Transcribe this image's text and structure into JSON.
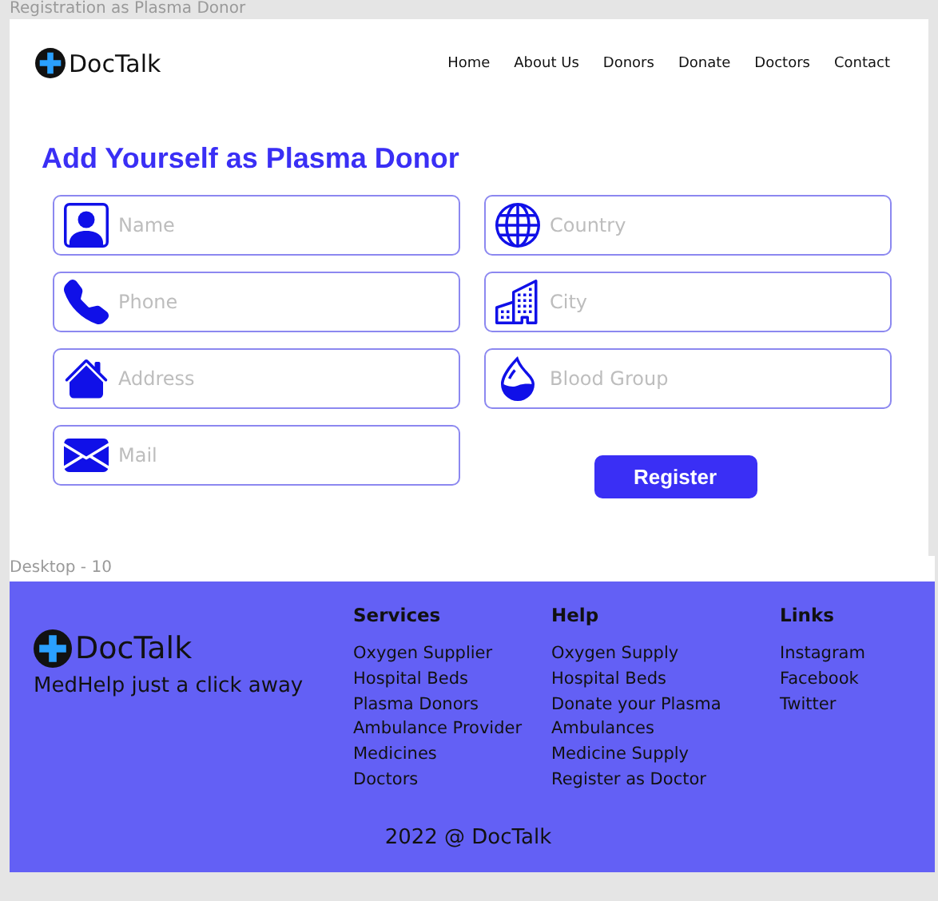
{
  "canvas_frames": [
    {
      "label": "Registration as Plasma Donor"
    },
    {
      "label": "Desktop - 10"
    }
  ],
  "header": {
    "brand": "DocTalk",
    "nav": [
      {
        "label": "Home"
      },
      {
        "label": "About Us"
      },
      {
        "label": "Donors"
      },
      {
        "label": "Donate"
      },
      {
        "label": "Doctors"
      },
      {
        "label": "Contact"
      }
    ]
  },
  "form": {
    "title": "Add Yourself as Plasma Donor",
    "left_fields": [
      {
        "placeholder": "Name",
        "kind": "person"
      },
      {
        "placeholder": "Phone",
        "kind": "phone"
      },
      {
        "placeholder": "Address",
        "kind": "house"
      },
      {
        "placeholder": "Mail",
        "kind": "mail"
      }
    ],
    "right_fields": [
      {
        "placeholder": "Country",
        "kind": "globe"
      },
      {
        "placeholder": "City",
        "kind": "building"
      },
      {
        "placeholder": "Blood Group",
        "kind": "drop"
      }
    ],
    "submit": "Register"
  },
  "footer": {
    "brand": "DocTalk",
    "tagline": "MedHelp just a click away",
    "columns": [
      {
        "heading": "Services",
        "items": [
          "Oxygen Supplier",
          "Hospital Beds",
          "Plasma Donors",
          "Ambulance Provider",
          "Medicines",
          "Doctors"
        ]
      },
      {
        "heading": "Help",
        "items": [
          "Oxygen Supply",
          "Hospital Beds",
          "Donate your Plasma",
          "Ambulances",
          "Medicine Supply",
          "Register as Doctor"
        ]
      },
      {
        "heading": "Links",
        "items": [
          "Instagram",
          "Facebook",
          "Twitter"
        ]
      }
    ],
    "copyright": "2022 @ DocTalk"
  }
}
